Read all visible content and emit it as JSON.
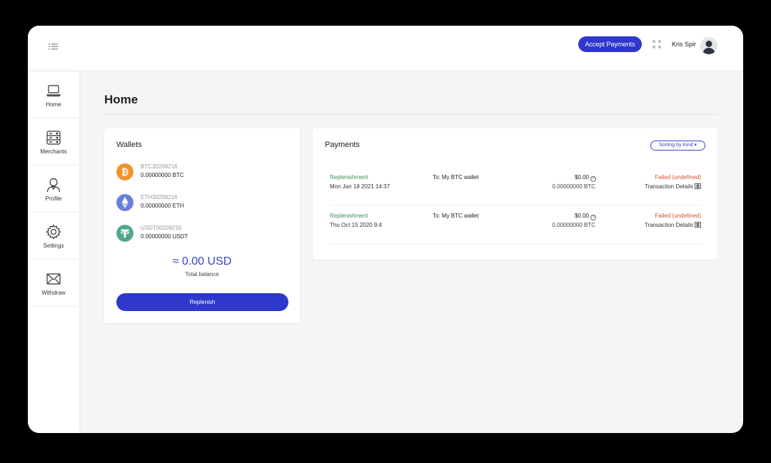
{
  "header": {
    "accept_payments_label": "Accept Payments",
    "user_name": "Kris Spir"
  },
  "sidebar": {
    "items": [
      {
        "label": "Home",
        "icon": "laptop-icon"
      },
      {
        "label": "Merchants",
        "icon": "server-icon"
      },
      {
        "label": "Profile",
        "icon": "user-icon"
      },
      {
        "label": "Settings",
        "icon": "gear-icon"
      },
      {
        "label": "Withdraw",
        "icon": "envelope-icon"
      }
    ]
  },
  "page": {
    "title": "Home"
  },
  "wallets": {
    "title": "Wallets",
    "items": [
      {
        "name": "BTC30208216",
        "amount": "0.00000000 BTC",
        "icon": "bitcoin-icon",
        "color": "#f0932b"
      },
      {
        "name": "ETH30208216",
        "amount": "0.00000000 ETH",
        "icon": "ethereum-icon",
        "color": "#6a7fdb"
      },
      {
        "name": "USDT30208216",
        "amount": "0.00000000 USDT",
        "icon": "tether-icon",
        "color": "#50a888"
      }
    ],
    "total_balance": "≈ 0.00 USD",
    "total_balance_label": "Total balance",
    "replenish_label": "Replenish"
  },
  "payments": {
    "title": "Payments",
    "sort_label": "Sorting by Kind",
    "rows": [
      {
        "kind": "Replenishment",
        "date": "Mon Jan 18 2021 14:37",
        "to": "To: My BTC wallet",
        "usd": "$0.00",
        "btc": "0.00000000 BTC",
        "status": "Failed (undefined)",
        "details": "Transaction Details"
      },
      {
        "kind": "Replenishment",
        "date": "Thu Oct 15 2020 9:4",
        "to": "To: My BTC wallet",
        "usd": "$0.00",
        "btc": "0.00000000 BTC",
        "status": "Failed (undefined)",
        "details": "Transaction Details"
      }
    ]
  },
  "colors": {
    "accent": "#2e38cc",
    "success": "#3c8c5a",
    "error": "#d4502e"
  }
}
